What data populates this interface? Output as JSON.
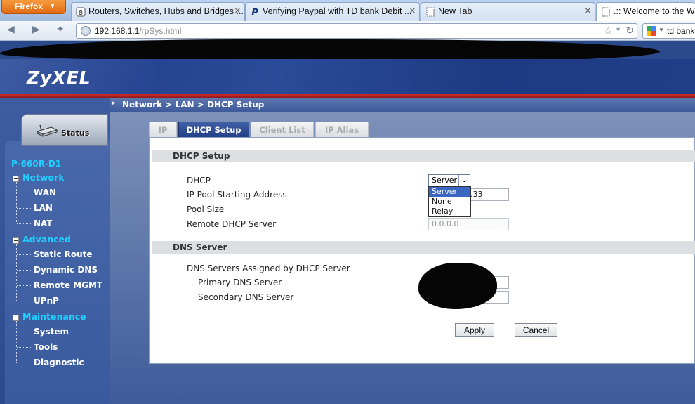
{
  "browser": {
    "menu_button": "Firefox",
    "tabs": [
      {
        "title": "Routers, Switches, Hubs and Bridges ...",
        "favicon": "network-icon"
      },
      {
        "title": "Verifying Paypal with TD bank Debit ...",
        "favicon": "paypal-icon"
      },
      {
        "title": "New Tab",
        "favicon": "blank-page-icon"
      },
      {
        "title": ".:: Welcome to the We",
        "favicon": "blank-page-icon"
      }
    ],
    "url_host": "192.168.1.1",
    "url_path": "/rpSys.html",
    "search_text": "td bank"
  },
  "header": {
    "logo": "ZyXEL",
    "brand_color": "#1f3b88",
    "accent_color": "#d22a2a"
  },
  "sidebar": {
    "status_label": "Status",
    "model": "P-660R-D1",
    "groups": [
      {
        "label": "Network",
        "items": [
          "WAN",
          "LAN",
          "NAT"
        ]
      },
      {
        "label": "Advanced",
        "items": [
          "Static Route",
          "Dynamic DNS",
          "Remote MGMT",
          "UPnP"
        ]
      },
      {
        "label": "Maintenance",
        "items": [
          "System",
          "Tools",
          "Diagnostic"
        ]
      }
    ]
  },
  "breadcrumb": "Network > LAN > DHCP Setup",
  "tabs": [
    "IP",
    "DHCP Setup",
    "Client List",
    "IP Alias"
  ],
  "active_tab": "DHCP Setup",
  "dhcp": {
    "section_title": "DHCP Setup",
    "dhcp_label": "DHCP",
    "dhcp_value": "Server",
    "dhcp_options": [
      "Server",
      "None",
      "Relay"
    ],
    "pool_start_label": "IP Pool Starting Address",
    "pool_start_value": ".33",
    "pool_size_label": "Pool Size",
    "remote_label": "Remote DHCP Server",
    "remote_value": "0.0.0.0"
  },
  "dns": {
    "section_title": "DNS Server",
    "assigned_label": "DNS Servers Assigned by DHCP Server",
    "primary_label": "Primary DNS Server",
    "secondary_label": "Secondary DNS Server"
  },
  "buttons": {
    "apply": "Apply",
    "cancel": "Cancel"
  }
}
